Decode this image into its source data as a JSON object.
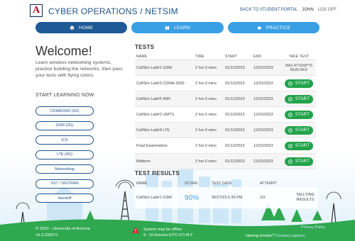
{
  "header": {
    "logo_letter": "A",
    "title": "CYBER OPERATIONS / NETSIM",
    "links": {
      "back": "BACK TO STUDENT PORTAL",
      "user": "JOHN",
      "logoff": "LOG OFF"
    }
  },
  "nav": {
    "home": "HOME",
    "learn": "LEARN",
    "practice": "PRACTICE"
  },
  "welcome": {
    "title": "Welcome!",
    "intro": "Learn wireless networking systems, practice building the networks, then pass your tests with flying colors.",
    "start_heading": "START LEARNING NOW",
    "topics": [
      "CDMA2000 (3G)",
      "GSM (2G)",
      "ICS",
      "LTE (4G)",
      "Networking",
      "SS7 / SIGTRAN",
      "Handoff"
    ]
  },
  "tests": {
    "title": "TESTS",
    "columns": [
      "NAME",
      "TIME",
      "START",
      "END",
      "TAKE TEST"
    ],
    "rows": [
      {
        "name": "CellSim Lab#1 GSM",
        "time": "2 hrs 0 mins",
        "start": "01/12/2023",
        "end": "12/31/2023",
        "action": "MAX ATTEMPTS REACHED"
      },
      {
        "name": "CellSim Lab#3 CDMA-2000",
        "time": "2 hrs 0 mins",
        "start": "01/12/2023",
        "end": "12/31/2023",
        "action": "START"
      },
      {
        "name": "CellSim Lab#5 WiFi",
        "time": "2 hrs 0 mins",
        "start": "01/12/2023",
        "end": "12/31/2023",
        "action": "START"
      },
      {
        "name": "CellSim Lab#2 UMTS",
        "time": "2 hrs 0 mins",
        "start": "01/12/2023",
        "end": "12/31/2023",
        "action": "START"
      },
      {
        "name": "CellSim Lab#4 LTE",
        "time": "2 hrs 0 mins",
        "start": "01/12/2023",
        "end": "12/31/2023",
        "action": "START"
      },
      {
        "name": "Final Examination",
        "time": "2 hrs 0 mins",
        "start": "01/12/2023",
        "end": "12/31/2023",
        "action": "START"
      },
      {
        "name": "Midterm",
        "time": "2 hrs 0 mins",
        "start": "01/12/2023",
        "end": "12/31/2023",
        "action": "START"
      }
    ]
  },
  "results": {
    "title": "TEST RESULTS",
    "columns": [
      "NAME",
      "SCORE",
      "TEST DATE",
      "ATTEMPT",
      ""
    ],
    "rows": [
      {
        "name": "CellSim Lab#1 GSM",
        "score": "90%",
        "date": "06/27/23 5:35 PM",
        "attempt": "2/2",
        "status": "TALLYING RESULTS"
      }
    ]
  },
  "footer": {
    "copyright": "© 2023 - University of Arizona",
    "version": "v5.3.232971",
    "alert_line1": "System may be offline",
    "alert_line2": "9 - 10 Arizona (UTC-07) M-F",
    "trouble_label": "Having trouble?",
    "trouble_link": "Contact support",
    "right_link": "Privacy Policy"
  },
  "colors": {
    "primary": "#1f5a96",
    "accent": "#3aa0e6",
    "start_green": "#22a34a",
    "grass": "#2fa84f"
  }
}
